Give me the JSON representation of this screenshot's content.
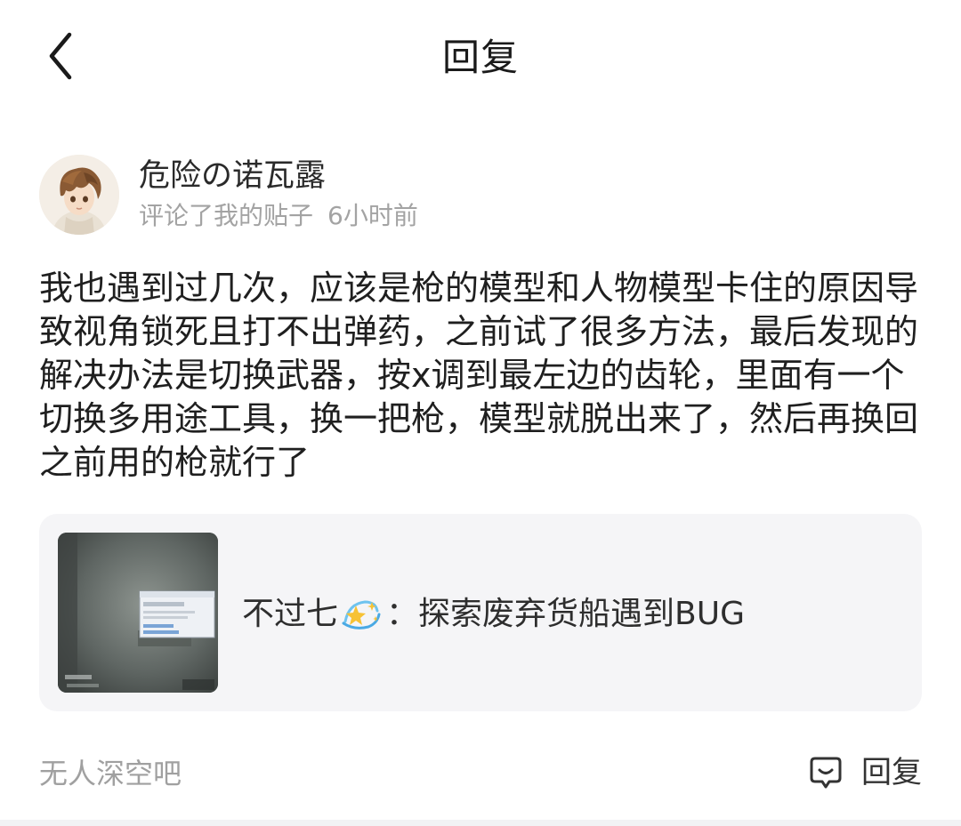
{
  "header": {
    "title": "回复",
    "back_icon": "chevron-left-icon"
  },
  "comment": {
    "username": "危险の诺瓦露",
    "action": "评论了我的贴子",
    "time": "6小时前",
    "avatar_icon": "avatar-anime-boy",
    "text": "我也遇到过几次，应该是枪的模型和人物模型卡住的原因导致视角锁死且打不出弹药，之前试了很多方法，最后发现的解决办法是切换武器，按x调到最左边的齿轮，里面有一个切换多用途工具，换一把枪，模型就脱出来了，然后再换回之前用的枪就行了"
  },
  "quoted_post": {
    "author": "不过七",
    "author_emoji": "sparkles-icon",
    "separator": "：",
    "title": "探索废弃货船遇到BUG",
    "thumbnail": "screenshot-thumbnail"
  },
  "footer": {
    "forum_name": "无人深空吧",
    "reply_icon": "comment-bubble-icon",
    "reply_label": "回复"
  },
  "colors": {
    "background": "#ffffff",
    "card_background": "#f5f5f7",
    "text_primary": "#1f1f1f",
    "text_secondary": "#a3a3a3"
  }
}
